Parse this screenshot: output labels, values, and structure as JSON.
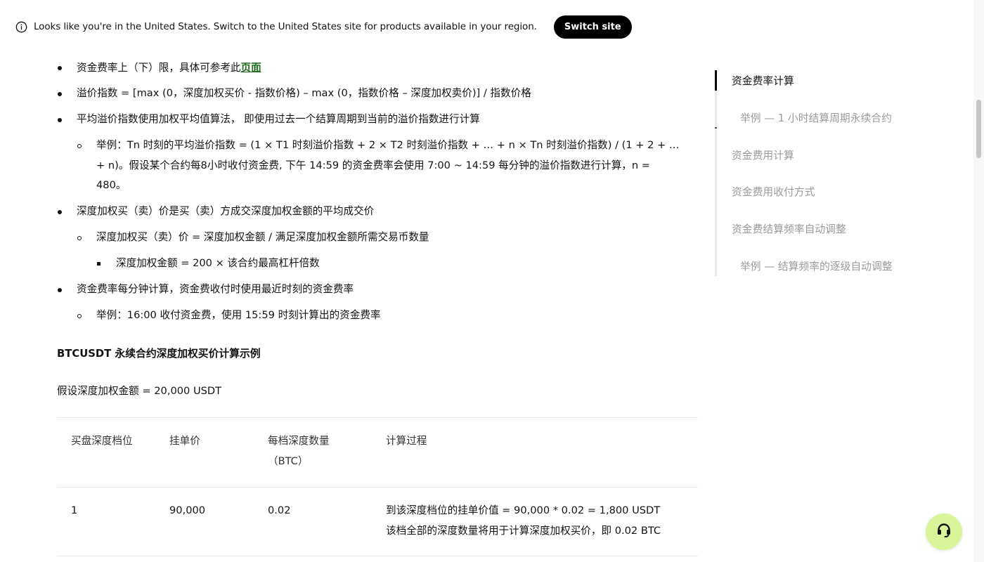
{
  "banner": {
    "text": "Looks like you're in the United States. Switch to the United States site for products available in your region.",
    "switch_label": "Switch site",
    "info_icon": "info-icon"
  },
  "bullets": {
    "rate_limit_prefix": "资金费率上（下）限，具体可参考此",
    "rate_limit_link": "页面",
    "premium_index": "溢价指数 = [max (0，深度加权买价 - 指数价格) – max (0，指数价格 – 深度加权卖价)] / 指数价格",
    "avg_premium": "平均溢价指数使用加权平均值算法， 即使用过去一个结算周期到当前的溢价指数进行计算",
    "avg_example": "举例：Tn 时刻的平均溢价指数 = (1 × T1 时刻溢价指数 + 2 × T2 时刻溢价指数 + … + n × Tn 时刻溢价指数) / (1 + 2 + … + n)。假设某个合约每8小时收付资金费, 下午 14:59 的资金费率会使用 7:00 ~ 14:59 每分钟的溢价指数进行计算，n = 480。",
    "depth_price": "深度加权买（卖）价是买（卖）方成交深度加权金额的平均成交价",
    "depth_formula": "深度加权买（卖）价 = 深度加权金额 / 满足深度加权金额所需交易币数量",
    "depth_amount": "深度加权金额 = 200 × 该合约最高杠杆倍数",
    "per_minute": "资金费率每分钟计算，资金费收付时使用最近时刻的资金费率",
    "per_minute_example": "举例：16:00 收付资金费，使用 15:59 时刻计算出的资金费率"
  },
  "example": {
    "title": "BTCUSDT 永续合约深度加权买价计算示例",
    "assumption": "假设深度加权金额 = 20,000 USDT"
  },
  "table": {
    "headers": [
      "买盘深度档位",
      "挂单价",
      "每档深度数量",
      "（BTC）",
      "计算过程"
    ],
    "rows": [
      {
        "level": "1",
        "price": "90,000",
        "qty": "0.02",
        "calc_line1": "到该深度档位的挂单价值 = 90,000 * 0.02 = 1,800 USDT",
        "calc_line2": "该档全部的深度数量将用于计算深度加权买价，即 0.02 BTC"
      }
    ]
  },
  "toc": {
    "items": [
      "资金费率计算",
      "举例 — 1 小时结算周期永续合约",
      "资金费用计算",
      "资金费用收付方式",
      "资金费结算频率自动调整",
      "举例 — 结算频率的逐级自动调整"
    ]
  },
  "support": {
    "icon": "headset-icon"
  }
}
